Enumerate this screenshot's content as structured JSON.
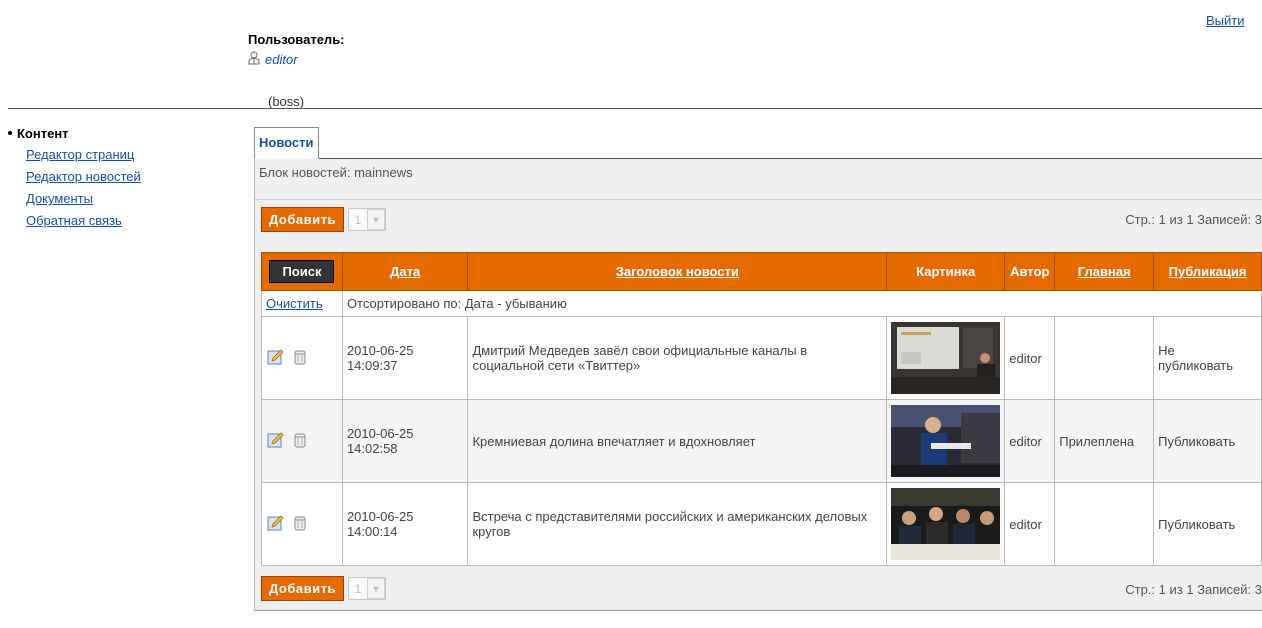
{
  "header": {
    "logout": "Выйти",
    "user_label": "Пользователь:",
    "username": "editor",
    "role": "(boss)"
  },
  "sidebar": {
    "title": "Контент",
    "items": [
      {
        "label": "Редактор страниц"
      },
      {
        "label": "Редактор новостей"
      },
      {
        "label": "Документы"
      },
      {
        "label": "Обратная связь"
      }
    ]
  },
  "tabs": [
    {
      "label": "Новости"
    }
  ],
  "block_info": "Блок новостей: mainnews",
  "toolbar": {
    "add_label": "Добавить",
    "page_select": "1",
    "pager": "Стр.: 1 из 1  Записей: 3"
  },
  "table": {
    "search_label": "Поиск",
    "columns": {
      "date": "Дата",
      "title": "Заголовок новости",
      "image": "Картинка",
      "author": "Автор",
      "main": "Главная",
      "publish": "Публикация"
    },
    "clear_label": "Очистить",
    "sort_info": "Отсортировано по: Дата - убыванию",
    "rows": [
      {
        "date": "2010-06-25",
        "time": "14:09:37",
        "title": "Дмитрий Медведев завёл свои официальные каналы в социальной сети «Твиттер»",
        "author": "editor",
        "main": "",
        "publish_line1": "Не",
        "publish_line2": "публиковать"
      },
      {
        "date": "2010-06-25",
        "time": "14:02:58",
        "title": "Кремниевая долина впечатляет и вдохновляет",
        "author": "editor",
        "main": "Прилеплена",
        "publish_line1": "Публиковать",
        "publish_line2": ""
      },
      {
        "date": "2010-06-25",
        "time": "14:00:14",
        "title": "Встреча с представителями российских и американских деловых кругов",
        "author": "editor",
        "main": "",
        "publish_line1": "Публиковать",
        "publish_line2": ""
      }
    ]
  },
  "colors": {
    "accent_orange": "#e56a00",
    "link_blue": "#1a4fa0",
    "search_button": "#333333"
  }
}
